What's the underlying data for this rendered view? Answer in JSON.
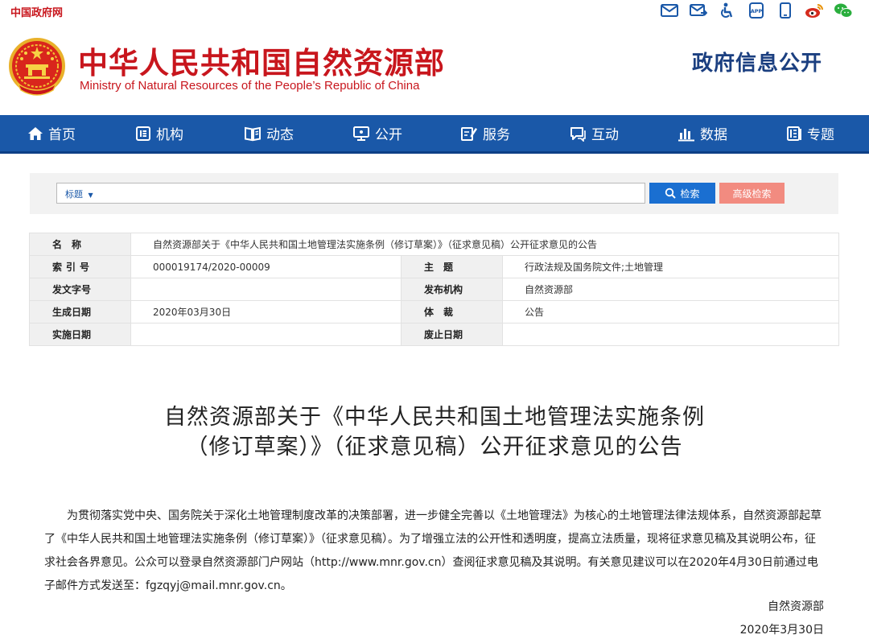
{
  "topbar": {
    "gov_link": "中国政府网",
    "icons": [
      "mail-icon",
      "mail-send-icon",
      "accessibility-icon",
      "app-icon",
      "mobile-icon",
      "weibo-icon",
      "wechat-icon"
    ],
    "app_icon_text": "APP"
  },
  "header": {
    "title_cn": "中华人民共和国自然资源部",
    "title_en": "Ministry of Natural Resources of the People’s Republic of China",
    "section": "政府信息公开"
  },
  "nav": {
    "items": [
      {
        "label": "首页",
        "icon": "home-icon"
      },
      {
        "label": "机构",
        "icon": "org-icon"
      },
      {
        "label": "动态",
        "icon": "book-icon"
      },
      {
        "label": "公开",
        "icon": "monitor-icon"
      },
      {
        "label": "服务",
        "icon": "edit-icon"
      },
      {
        "label": "互动",
        "icon": "chat-icon"
      },
      {
        "label": "数据",
        "icon": "chart-icon"
      },
      {
        "label": "专题",
        "icon": "topic-icon"
      }
    ]
  },
  "search": {
    "field_selector": "标题",
    "value": "",
    "search_label": "检索",
    "advanced_label": "高级检索"
  },
  "meta": {
    "name_label": "名　称",
    "name_value": "自然资源部关于《中华人民共和国土地管理法实施条例（修订草案）》（征求意见稿）公开征求意见的公告",
    "index_label": "索引号",
    "index_value": "000019174/2020-00009",
    "topic_label": "主　题",
    "topic_value": "行政法规及国务院文件;土地管理",
    "docno_label": "发文字号",
    "docno_value": "",
    "issuer_label": "发布机构",
    "issuer_value": "自然资源部",
    "date_label": "生成日期",
    "date_value": "2020年03月30日",
    "genre_label": "体　裁",
    "genre_value": "公告",
    "effective_label": "实施日期",
    "effective_value": "",
    "expiry_label": "废止日期",
    "expiry_value": ""
  },
  "article": {
    "title": "自然资源部关于《中华人民共和国土地管理法实施条例（修订草案）》（征求意见稿）公开征求意见的公告",
    "body": "为贯彻落实党中央、国务院关于深化土地管理制度改革的决策部署，进一步健全完善以《土地管理法》为核心的土地管理法律法规体系，自然资源部起草了《中华人民共和国土地管理法实施条例（修订草案）》（征求意见稿）。为了增强立法的公开性和透明度，提高立法质量，现将征求意见稿及其说明公布，征求社会各界意见。公众可以登录自然资源部门户网站（http://www.mnr.gov.cn）查阅征求意见稿及其说明。有关意见建议可以在2020年4月30日前通过电子邮件方式发送至：fgzqyj@mail.mnr.gov.cn。",
    "signature_org": "自然资源部",
    "signature_date": "2020年3月30日"
  },
  "colors": {
    "brand_red": "#c8161d",
    "nav_blue": "#1a58a8",
    "section_blue": "#1b3f80",
    "search_blue": "#1a6fd1",
    "advanced_pink": "#f28b80"
  }
}
